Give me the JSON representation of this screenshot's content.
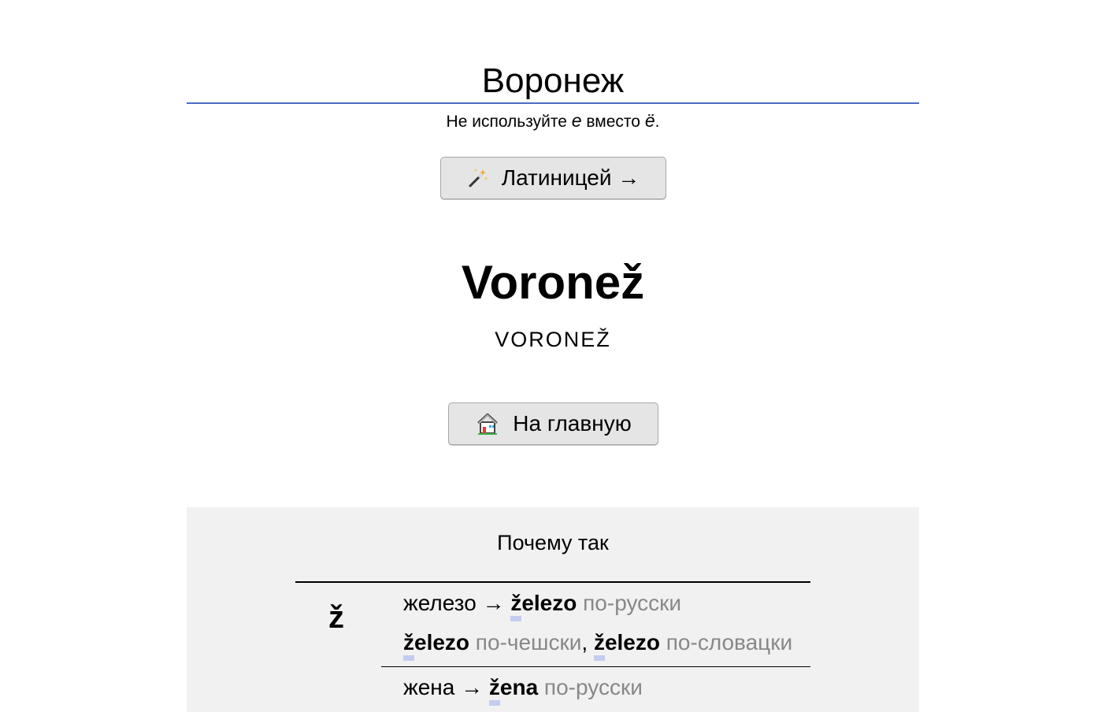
{
  "input": {
    "value": "Воронеж"
  },
  "hint": {
    "prefix": "Не используйте ",
    "e": "е",
    "middle": " вместо ",
    "yo": "ё",
    "suffix": "."
  },
  "latin_button": {
    "icon": "magic-wand-icon",
    "label": "Латиницей →"
  },
  "result": {
    "latin": "Voronež",
    "latin_caps": "VORONEŽ"
  },
  "home_button": {
    "icon": "house-icon",
    "label": "На главную"
  },
  "why": {
    "title": "Почему так",
    "letter": "ž",
    "rows": [
      {
        "cyr": "железо → ",
        "lat": "železo",
        "note": " по-русски"
      },
      {
        "lat1": "železo",
        "note1": " по-чешски",
        "sep": ", ",
        "lat2": "železo",
        "note2": " по-словацки"
      },
      {
        "cyr": "жена → ",
        "lat": "žena",
        "note": " по-русски"
      }
    ]
  },
  "colors": {
    "accent": "#4a6cc6",
    "panel": "#f1f1f1",
    "highlight": "#c4cdf0"
  }
}
